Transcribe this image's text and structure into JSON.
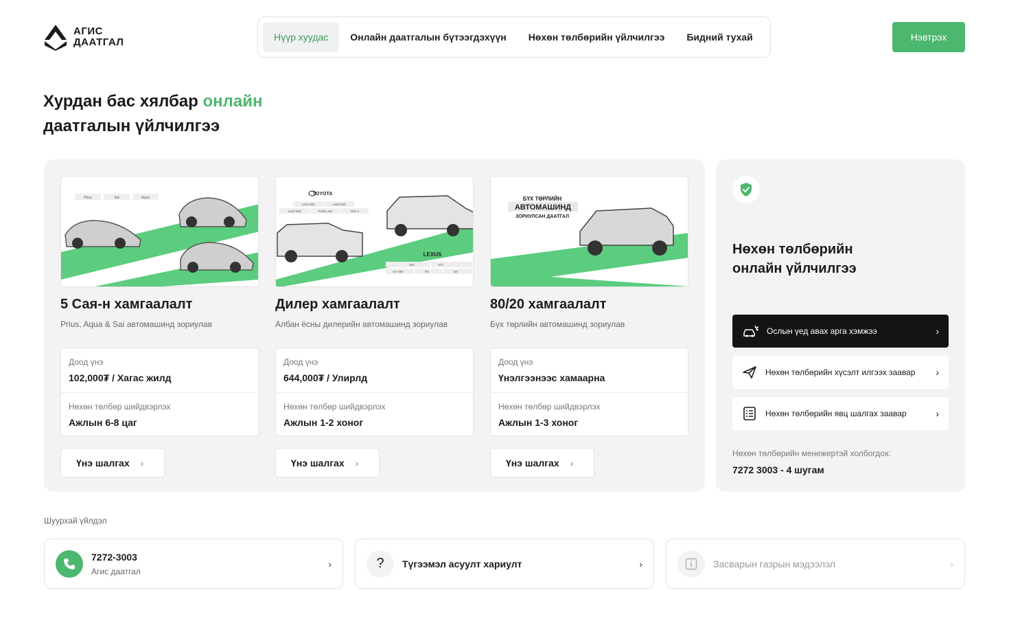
{
  "header": {
    "logo_line1": "АГИС",
    "logo_line2": "ДААТГАЛ",
    "nav": [
      {
        "label": "Нүүр хуудас",
        "active": true
      },
      {
        "label": "Онлайн даатгалын бүтээгдэхүүн"
      },
      {
        "label": "Нөхөн төлбөрийн үйлчилгээ"
      },
      {
        "label": "Бидний тухай"
      }
    ],
    "login_label": "Нэвтрэх"
  },
  "hero": {
    "line1_prefix": "Хурдан бас хялбар ",
    "line1_accent": "онлайн",
    "line2": "даатгалын үйлчилгээ"
  },
  "products": [
    {
      "title": "5 Сая-н хамгаалалт",
      "subtitle": "Prius, Aqua & Sai автомашинд зориулав",
      "img_tags": [
        "Prius",
        "Sai",
        "Aqua"
      ],
      "price_label": "Доод үнэ",
      "price_value": "102,000₮ / Хагас жилд",
      "claim_label": "Нөхөн төлбөр шийдвэрлэх",
      "claim_value": "Ажлын 6-8 цаг",
      "button": "Үнэ шалгах"
    },
    {
      "title": "Дилер хамгаалалт",
      "subtitle": "Албан ёсны дилерийн автомашинд зориулав",
      "img_brand1": "TOYOTA",
      "img_brand2": "LEXUS",
      "img_tags1": [
        "Land 300",
        "Land 250",
        "Land 200",
        "Prado 150",
        "Rav 4"
      ],
      "img_tags2": [
        "600",
        "570",
        "GX 550",
        "RX",
        "NX"
      ],
      "price_label": "Доод үнэ",
      "price_value": "644,000₮ / Улирлд",
      "claim_label": "Нөхөн төлбөр шийдвэрлэх",
      "claim_value": "Ажлын 1-2 хоног",
      "button": "Үнэ шалгах"
    },
    {
      "title": "80/20 хамгаалалт",
      "subtitle": "Бүх төрлийн автомашинд зориулав",
      "img_line1": "БҮХ ТӨРЛИЙН",
      "img_line2": "АВТОМАШИНД",
      "img_line3": "ЗОРИУЛСАН ДААТГАЛ",
      "price_label": "Доод үнэ",
      "price_value": "Үнэлгээнээс хамаарна",
      "claim_label": "Нөхөн төлбөр шийдвэрлэх",
      "claim_value": "Ажлын 1-3 хоног",
      "button": "Үнэ шалгах"
    }
  ],
  "claims": {
    "title_line1": "Нөхөн төлбөрийн",
    "title_line2": "онлайн үйлчилгээ",
    "links": [
      {
        "label": "Ослын үед авах арга хэмжээ",
        "icon": "car-crash-icon",
        "dark": true
      },
      {
        "label": "Нөхөн төлбөрийн хүсэлт илгээх заавар",
        "icon": "send-icon"
      },
      {
        "label": "Нөхөн төлбөрийн явц шалгах заавар",
        "icon": "checklist-icon"
      }
    ],
    "manager_label": "Нөхөн төлбөрийн менежертэй холбогдох:",
    "manager_phone": "7272 3003 - 4 шугам"
  },
  "quick": {
    "label": "Шуурхай үйлдэл",
    "items": [
      {
        "title": "7272-3003",
        "subtitle": "Агис даатгал",
        "icon": "phone-icon"
      },
      {
        "title": "Түгээмэл асуулт хариулт",
        "icon": "question-icon"
      },
      {
        "title": "Засварын газрын мэдээлэл",
        "icon": "info-icon",
        "disabled": true
      }
    ]
  },
  "colors": {
    "accent": "#4cb76e",
    "panel_bg": "#f3f3f4",
    "dark": "#141414"
  }
}
